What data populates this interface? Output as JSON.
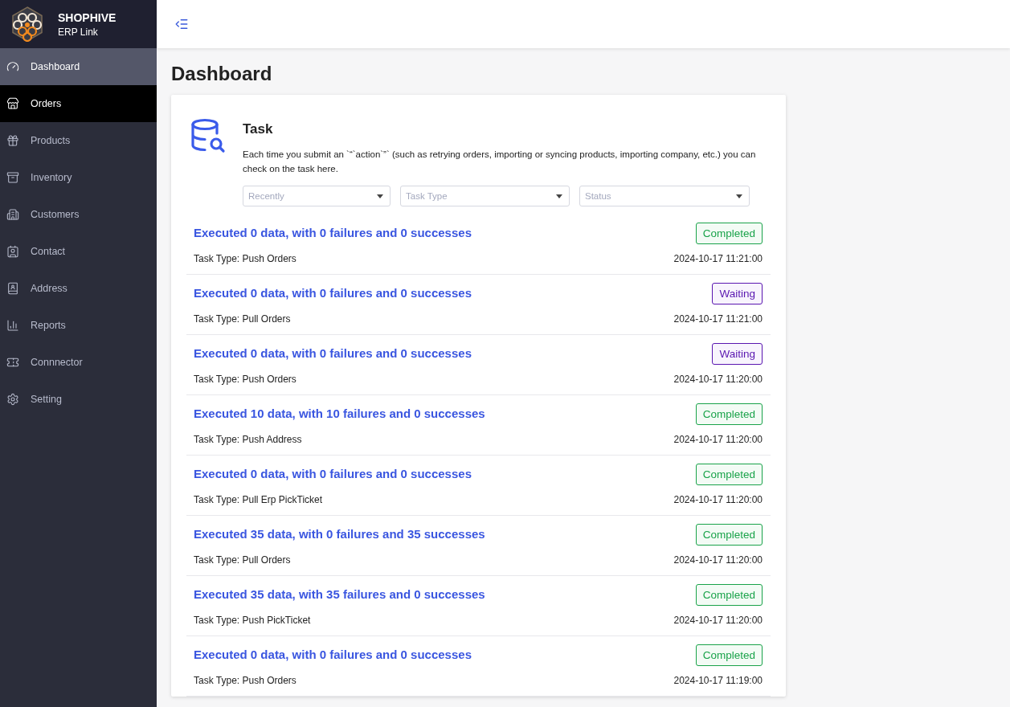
{
  "brand": {
    "name": "SHOPHIVE",
    "subtitle": "ERP Link"
  },
  "sidebar": {
    "items": [
      {
        "label": "Dashboard",
        "selected": true,
        "hovered": false
      },
      {
        "label": "Orders",
        "selected": false,
        "hovered": true
      },
      {
        "label": "Products",
        "selected": false,
        "hovered": false
      },
      {
        "label": "Inventory",
        "selected": false,
        "hovered": false
      },
      {
        "label": "Customers",
        "selected": false,
        "hovered": false
      },
      {
        "label": "Contact",
        "selected": false,
        "hovered": false
      },
      {
        "label": "Address",
        "selected": false,
        "hovered": false
      },
      {
        "label": "Reports",
        "selected": false,
        "hovered": false
      },
      {
        "label": "Connnector",
        "selected": false,
        "hovered": false
      },
      {
        "label": "Setting",
        "selected": false,
        "hovered": false
      }
    ]
  },
  "page_title": "Dashboard",
  "task_card": {
    "title": "Task",
    "description": "Each time you submit an `“`action`”` (such as retrying orders, importing or syncing products, importing company, etc.) you can check on the task here.",
    "filters": [
      {
        "placeholder": "Recently"
      },
      {
        "placeholder": "Task Type"
      },
      {
        "placeholder": "Status"
      }
    ],
    "tasks": [
      {
        "summary": "Executed 0 data, with 0 failures and 0 successes",
        "task_type": "Task Type: Push Orders",
        "status": "Completed",
        "time": "2024-10-17 11:21:00"
      },
      {
        "summary": "Executed 0 data, with 0 failures and 0 successes",
        "task_type": "Task Type: Pull Orders",
        "status": "Waiting",
        "time": "2024-10-17 11:21:00"
      },
      {
        "summary": "Executed 0 data, with 0 failures and 0 successes",
        "task_type": "Task Type: Push Orders",
        "status": "Waiting",
        "time": "2024-10-17 11:20:00"
      },
      {
        "summary": "Executed 10 data, with 10 failures and 0 successes",
        "task_type": "Task Type: Push Address",
        "status": "Completed",
        "time": "2024-10-17 11:20:00"
      },
      {
        "summary": "Executed 0 data, with 0 failures and 0 successes",
        "task_type": "Task Type: Pull Erp PickTicket",
        "status": "Completed",
        "time": "2024-10-17 11:20:00"
      },
      {
        "summary": "Executed 35 data, with 0 failures and 35 successes",
        "task_type": "Task Type: Pull Orders",
        "status": "Completed",
        "time": "2024-10-17 11:20:00"
      },
      {
        "summary": "Executed 35 data, with 35 failures and 0 successes",
        "task_type": "Task Type: Push PickTicket",
        "status": "Completed",
        "time": "2024-10-17 11:20:00"
      },
      {
        "summary": "Executed 0 data, with 0 failures and 0 successes",
        "task_type": "Task Type: Push Orders",
        "status": "Completed",
        "time": "2024-10-17 11:19:00"
      }
    ]
  }
}
